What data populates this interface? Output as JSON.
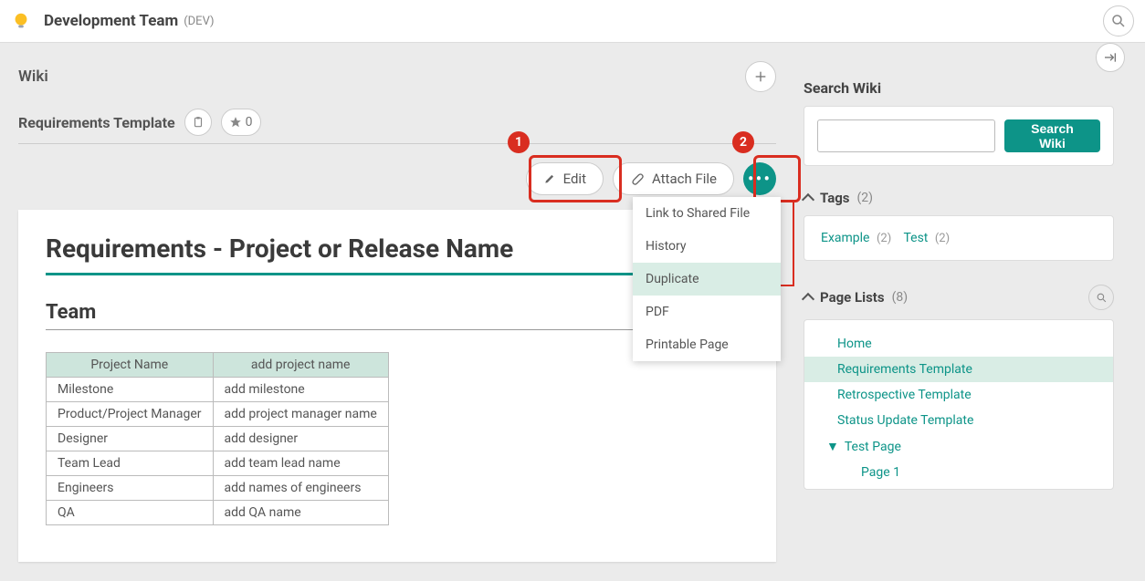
{
  "topbar": {
    "team_name": "Development Team",
    "team_code": "(DEV)"
  },
  "wiki_label": "Wiki",
  "page_title": "Requirements Template",
  "star_count": "0",
  "toolbar": {
    "edit": "Edit",
    "attach": "Attach File"
  },
  "callouts": {
    "one": "1",
    "two": "2"
  },
  "dropdown": {
    "link_shared": "Link to Shared File",
    "history": "History",
    "duplicate": "Duplicate",
    "pdf": "PDF",
    "printable": "Printable Page"
  },
  "doc": {
    "title": "Requirements - Project or Release Name",
    "section_team": "Team",
    "table": {
      "header_left": "Project Name",
      "header_right": "add project name",
      "rows": [
        {
          "l": "Milestone",
          "r": "add milestone"
        },
        {
          "l": "Product/Project Manager",
          "r": "add project manager name"
        },
        {
          "l": "Designer",
          "r": "add designer"
        },
        {
          "l": "Team Lead",
          "r": "add team lead name"
        },
        {
          "l": "Engineers",
          "r": "add names of engineers"
        },
        {
          "l": "QA",
          "r": "add QA name"
        }
      ]
    }
  },
  "sidebar": {
    "search_title": "Search Wiki",
    "search_btn": "Search Wiki",
    "tags_title": "Tags",
    "tags_count": "(2)",
    "tags": [
      {
        "name": "Example",
        "count": "(2)"
      },
      {
        "name": "Test",
        "count": "(2)"
      }
    ],
    "pagelists_title": "Page Lists",
    "pagelists_count": "(8)",
    "pages": {
      "home": "Home",
      "req": "Requirements Template",
      "retro": "Retrospective Template",
      "status": "Status Update Template",
      "test": "Test Page",
      "page1": "Page 1"
    }
  }
}
